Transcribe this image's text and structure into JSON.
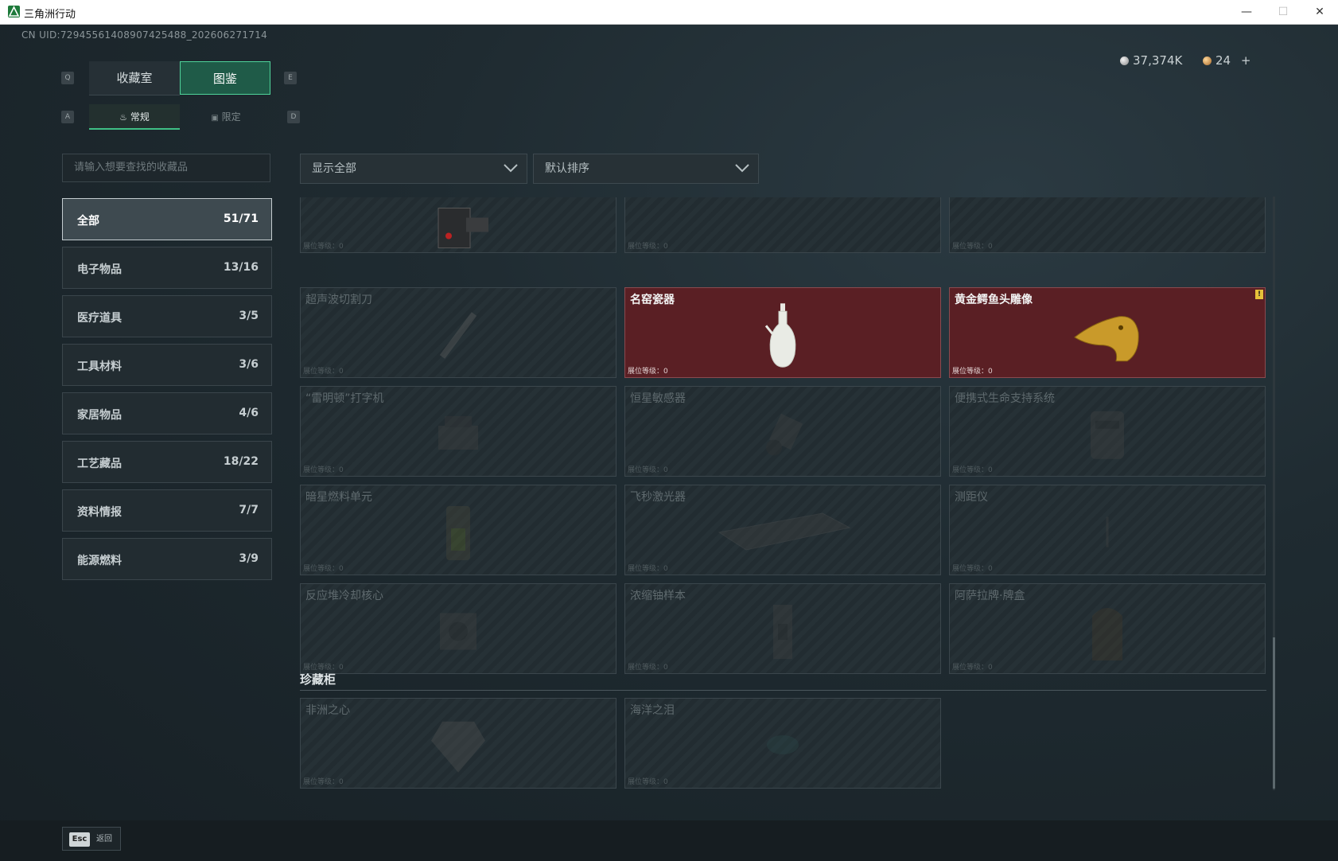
{
  "window": {
    "title": "三角洲行动",
    "min": "—",
    "max": "☐",
    "close": "✕"
  },
  "uid": "CN UID:72945561408907425488_202606271714",
  "key_hints": {
    "q": "Q",
    "e": "E",
    "a": "A",
    "d": "D"
  },
  "tabs": {
    "collection": "收藏室",
    "gallery": "图鉴"
  },
  "subtabs": {
    "normal": "常规",
    "limited": "限定"
  },
  "currency": {
    "silver": "37,374K",
    "gold": "24",
    "add": "+"
  },
  "search": {
    "placeholder": "请输入想要查找的收藏品"
  },
  "filters": {
    "show": "显示全部",
    "sort": "默认排序"
  },
  "categories": [
    {
      "label": "全部",
      "count": "51/71"
    },
    {
      "label": "电子物品",
      "count": "13/16"
    },
    {
      "label": "医疗道具",
      "count": "3/5"
    },
    {
      "label": "工具材料",
      "count": "3/6"
    },
    {
      "label": "家居物品",
      "count": "4/6"
    },
    {
      "label": "工艺藏品",
      "count": "18/22"
    },
    {
      "label": "资料情报",
      "count": "7/7"
    },
    {
      "label": "能源燃料",
      "count": "3/9"
    }
  ],
  "cards": [
    {
      "name": "",
      "level": "展位等级：0",
      "owned": true
    },
    {
      "name": "",
      "level": "展位等级：0",
      "owned": false
    },
    {
      "name": "",
      "level": "展位等级：0",
      "owned": false
    },
    {
      "name": "超声波切割刀",
      "level": "展位等级：0",
      "owned": false
    },
    {
      "name": "名窑瓷器",
      "level": "展位等级：0",
      "owned": true
    },
    {
      "name": "黄金鳄鱼头雕像",
      "level": "展位等级：0",
      "owned": true,
      "badge": "!"
    },
    {
      "name": "“雷明顿”打字机",
      "level": "展位等级：0",
      "owned": false
    },
    {
      "name": "恒星敏感器",
      "level": "展位等级：0",
      "owned": false
    },
    {
      "name": "便携式生命支持系统",
      "level": "展位等级：0",
      "owned": false
    },
    {
      "name": "暗星燃料单元",
      "level": "展位等级：0",
      "owned": false
    },
    {
      "name": "飞秒激光器",
      "level": "展位等级：0",
      "owned": false
    },
    {
      "name": "测距仪",
      "level": "展位等级：0",
      "owned": false
    },
    {
      "name": "反应堆冷却核心",
      "level": "展位等级：0",
      "owned": false
    },
    {
      "name": "浓缩铀样本",
      "level": "展位等级：0",
      "owned": false
    },
    {
      "name": "阿萨拉牌·牌盒",
      "level": "展位等级：0",
      "owned": false
    }
  ],
  "treasure_section": "珍藏柜",
  "treasure_cards": [
    {
      "name": "非洲之心",
      "level": "展位等级：0"
    },
    {
      "name": "海洋之泪",
      "level": "展位等级：0"
    }
  ],
  "footer": {
    "esc_key": "Esc",
    "back": "返回"
  }
}
